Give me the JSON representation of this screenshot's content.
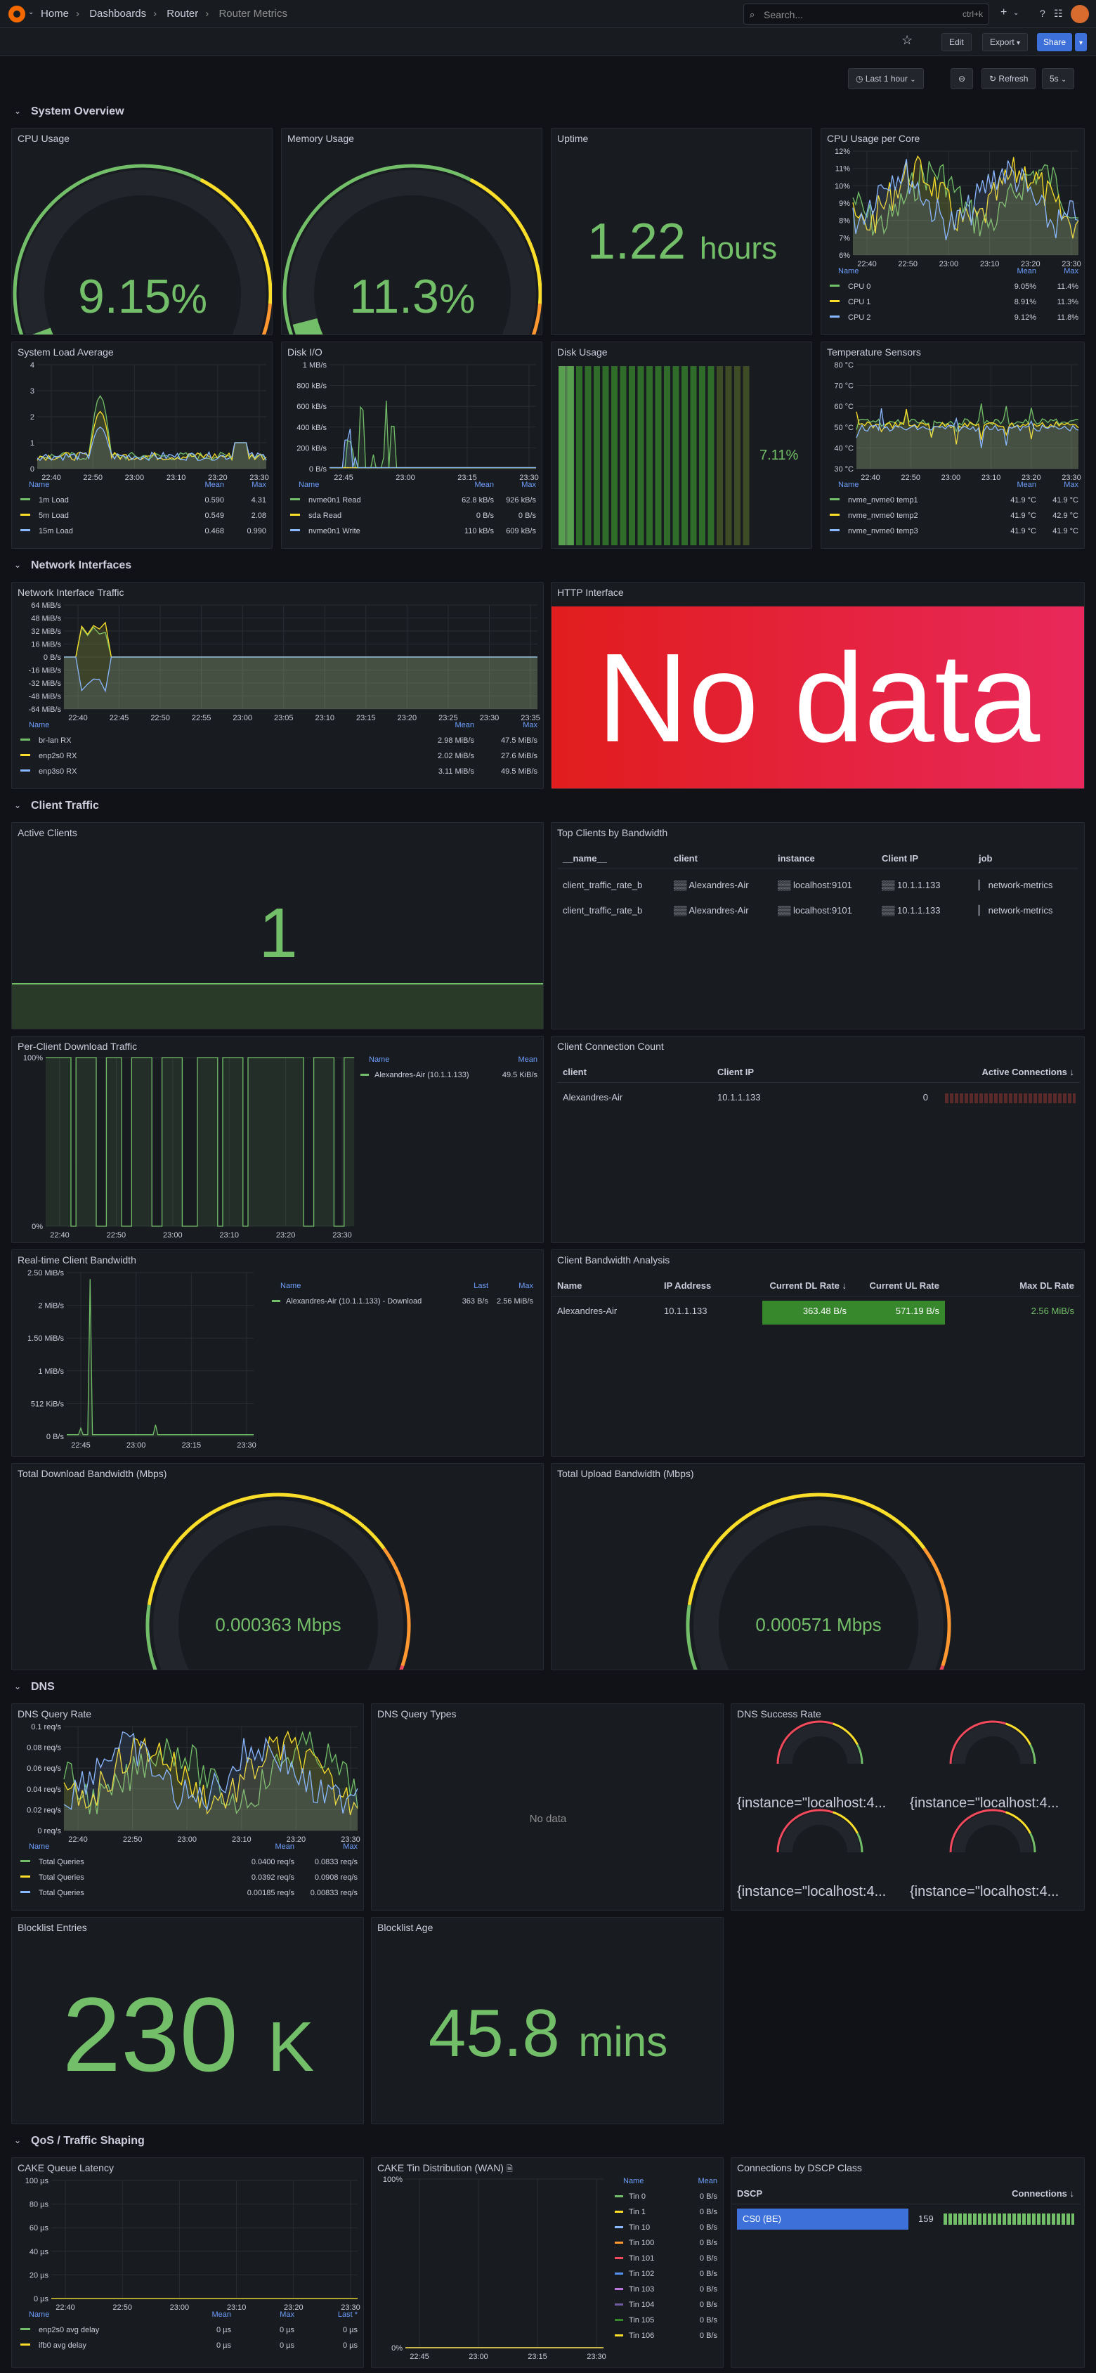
{
  "nav": {
    "crumbs": [
      "Home",
      "Dashboards",
      "Router",
      "Router Metrics"
    ],
    "search_placeholder": "Search...",
    "search_shortcut": "ctrl+k",
    "plus": "+"
  },
  "toolbar": {
    "edit": "Edit",
    "export": "Export",
    "share": "Share",
    "time_range": "Last 1 hour",
    "refresh": "Refresh",
    "refresh_interval": "5s"
  },
  "sections": {
    "system": "System Overview",
    "network": "Network Interfaces",
    "client": "Client Traffic",
    "dns": "DNS",
    "qos": "QoS / Traffic Shaping"
  },
  "cpu": {
    "title": "CPU Usage",
    "value": "9.15",
    "unit": "%",
    "fraction": 0.0915
  },
  "mem": {
    "title": "Memory Usage",
    "value": "11.3",
    "unit": "%",
    "fraction": 0.113
  },
  "uptime": {
    "title": "Uptime",
    "value": "1.22",
    "unit": "hours"
  },
  "cpucore": {
    "title": "CPU Usage per Core",
    "yticks": [
      "12%",
      "11%",
      "10%",
      "9%",
      "8%",
      "7%",
      "6%"
    ],
    "xticks": [
      "22:40",
      "22:50",
      "23:00",
      "23:10",
      "23:20",
      "23:30"
    ],
    "legend_cols": [
      "Name",
      "Mean",
      "Max"
    ],
    "rows": [
      {
        "name": "CPU 0",
        "mean": "9.05%",
        "max": "11.4%",
        "color": "#73bf69"
      },
      {
        "name": "CPU 1",
        "mean": "8.91%",
        "max": "11.3%",
        "color": "#fade2a"
      },
      {
        "name": "CPU 2",
        "mean": "9.12%",
        "max": "11.8%",
        "color": "#8ab8ff"
      }
    ]
  },
  "load": {
    "title": "System Load Average",
    "yticks": [
      "4",
      "3",
      "2",
      "1",
      "0"
    ],
    "xticks": [
      "22:40",
      "22:50",
      "23:00",
      "23:10",
      "23:20",
      "23:30"
    ],
    "legend_cols": [
      "Name",
      "Mean",
      "Max"
    ],
    "rows": [
      {
        "name": "1m Load",
        "mean": "0.590",
        "max": "4.31",
        "color": "#73bf69"
      },
      {
        "name": "5m Load",
        "mean": "0.549",
        "max": "2.08",
        "color": "#fade2a"
      },
      {
        "name": "15m Load",
        "mean": "0.468",
        "max": "0.990",
        "color": "#8ab8ff"
      }
    ]
  },
  "diskio": {
    "title": "Disk I/O",
    "yticks": [
      "1 MB/s",
      "800 kB/s",
      "600 kB/s",
      "400 kB/s",
      "200 kB/s",
      "0 B/s"
    ],
    "xticks": [
      "22:45",
      "23:00",
      "23:15",
      "23:30"
    ],
    "legend_cols": [
      "Name",
      "Mean",
      "Max"
    ],
    "rows": [
      {
        "name": "nvme0n1 Read",
        "mean": "62.8 kB/s",
        "max": "926 kB/s",
        "color": "#73bf69"
      },
      {
        "name": "sda Read",
        "mean": "0 B/s",
        "max": "0 B/s",
        "color": "#fade2a"
      },
      {
        "name": "nvme0n1 Write",
        "mean": "110 kB/s",
        "max": "609 kB/s",
        "color": "#8ab8ff"
      }
    ]
  },
  "disk": {
    "title": "Disk Usage",
    "value": "7.11%",
    "fraction": 0.0711
  },
  "temp": {
    "title": "Temperature Sensors",
    "yticks": [
      "80 °C",
      "70 °C",
      "60 °C",
      "50 °C",
      "40 °C",
      "30 °C"
    ],
    "xticks": [
      "22:40",
      "22:50",
      "23:00",
      "23:10",
      "23:20",
      "23:30"
    ],
    "legend_cols": [
      "Name",
      "Mean",
      "Max"
    ],
    "rows": [
      {
        "name": "nvme_nvme0 temp1",
        "mean": "41.9 °C",
        "max": "41.9 °C",
        "color": "#73bf69"
      },
      {
        "name": "nvme_nvme0 temp2",
        "mean": "41.9 °C",
        "max": "42.9 °C",
        "color": "#fade2a"
      },
      {
        "name": "nvme_nvme0 temp3",
        "mean": "41.9 °C",
        "max": "41.9 °C",
        "color": "#8ab8ff"
      }
    ]
  },
  "netif": {
    "title": "Network Interface Traffic",
    "yticks": [
      "64 MiB/s",
      "48 MiB/s",
      "32 MiB/s",
      "16 MiB/s",
      "0 B/s",
      "-16 MiB/s",
      "-32 MiB/s",
      "-48 MiB/s",
      "-64 MiB/s"
    ],
    "xticks": [
      "22:40",
      "22:45",
      "22:50",
      "22:55",
      "23:00",
      "23:05",
      "23:10",
      "23:15",
      "23:20",
      "23:25",
      "23:30",
      "23:35"
    ],
    "legend_cols": [
      "Name",
      "Mean",
      "Max"
    ],
    "rows": [
      {
        "name": "br-lan RX",
        "mean": "2.98 MiB/s",
        "max": "47.5 MiB/s",
        "color": "#73bf69"
      },
      {
        "name": "enp2s0 RX",
        "mean": "2.02 MiB/s",
        "max": "27.6 MiB/s",
        "color": "#fade2a"
      },
      {
        "name": "enp3s0 RX",
        "mean": "3.11 MiB/s",
        "max": "49.5 MiB/s",
        "color": "#8ab8ff"
      }
    ]
  },
  "http": {
    "title": "HTTP Interface",
    "value": "No data"
  },
  "active": {
    "title": "Active Clients",
    "value": "1"
  },
  "topclients": {
    "title": "Top Clients by Bandwidth",
    "cols": [
      "__name__",
      "client",
      "instance",
      "Client IP",
      "job"
    ],
    "rows": [
      [
        "client_traffic_rate_b",
        "Alexandres-Air",
        "localhost:9101",
        "10.1.1.133",
        "network-metrics"
      ],
      [
        "client_traffic_rate_b",
        "Alexandres-Air",
        "localhost:9101",
        "10.1.1.133",
        "network-metrics"
      ]
    ]
  },
  "perclient": {
    "title": "Per-Client Download Traffic",
    "yticks": [
      "100%",
      "0%"
    ],
    "xticks": [
      "22:40",
      "22:50",
      "23:00",
      "23:10",
      "23:20",
      "23:30"
    ],
    "legend_cols": [
      "Name",
      "Mean"
    ],
    "rows": [
      {
        "name": "Alexandres-Air (10.1.1.133)",
        "mean": "49.5 KiB/s",
        "color": "#73bf69"
      }
    ]
  },
  "conncount": {
    "title": "Client Connection Count",
    "cols": [
      "client",
      "Client IP",
      "Active Connections"
    ],
    "rows": [
      {
        "client": "Alexandres-Air",
        "ip": "10.1.1.133",
        "count": "0"
      }
    ]
  },
  "rtbw": {
    "title": "Real-time Client Bandwidth",
    "yticks": [
      "2.50 MiB/s",
      "2 MiB/s",
      "1.50 MiB/s",
      "1 MiB/s",
      "512 KiB/s",
      "0 B/s"
    ],
    "xticks": [
      "22:45",
      "23:00",
      "23:15",
      "23:30"
    ],
    "legend_cols": [
      "Name",
      "Last",
      "Max"
    ],
    "rows": [
      {
        "name": "Alexandres-Air (10.1.1.133) - Download",
        "last": "363 B/s",
        "max": "2.56 MiB/s",
        "color": "#73bf69"
      }
    ]
  },
  "bwanalysis": {
    "title": "Client Bandwidth Analysis",
    "cols": [
      "Name",
      "IP Address",
      "Current DL Rate",
      "Current UL Rate",
      "Max DL Rate"
    ],
    "rows": [
      {
        "name": "Alexandres-Air",
        "ip": "10.1.1.133",
        "dl": "363.48 B/s",
        "ul": "571.19 B/s",
        "max": "2.56 MiB/s"
      }
    ]
  },
  "totaldl": {
    "title": "Total Download Bandwidth (Mbps)",
    "value": "0.000363 Mbps"
  },
  "totalul": {
    "title": "Total Upload Bandwidth (Mbps)",
    "value": "0.000571 Mbps"
  },
  "dnsrate": {
    "title": "DNS Query Rate",
    "yticks": [
      "0.1 req/s",
      "0.08 req/s",
      "0.06 req/s",
      "0.04 req/s",
      "0.02 req/s",
      "0 req/s"
    ],
    "xticks": [
      "22:40",
      "22:50",
      "23:00",
      "23:10",
      "23:20",
      "23:30"
    ],
    "legend_cols": [
      "Name",
      "Mean",
      "Max"
    ],
    "rows": [
      {
        "name": "Total Queries",
        "mean": "0.0400 req/s",
        "max": "0.0833 req/s",
        "color": "#73bf69"
      },
      {
        "name": "Total Queries",
        "mean": "0.0392 req/s",
        "max": "0.0908 req/s",
        "color": "#fade2a"
      },
      {
        "name": "Total Queries",
        "mean": "0.00185 req/s",
        "max": "0.00833 req/s",
        "color": "#8ab8ff"
      }
    ]
  },
  "dnstypes": {
    "title": "DNS Query Types",
    "value": "No data"
  },
  "dnssuccess": {
    "title": "DNS Success Rate",
    "labels": [
      "{instance=\"localhost:4...",
      "{instance=\"localhost:4...",
      "{instance=\"localhost:4...",
      "{instance=\"localhost:4..."
    ]
  },
  "blocklist": {
    "title": "Blocklist Entries",
    "value": "230",
    "unit": "K"
  },
  "blockage": {
    "title": "Blocklist Age",
    "value": "45.8",
    "unit": "mins"
  },
  "cakelat": {
    "title": "CAKE Queue Latency",
    "yticks": [
      "100 µs",
      "80 µs",
      "60 µs",
      "40 µs",
      "20 µs",
      "0 µs"
    ],
    "xticks": [
      "22:40",
      "22:50",
      "23:00",
      "23:10",
      "23:20",
      "23:30"
    ],
    "legend_cols": [
      "Name",
      "Mean",
      "Max",
      "Last *"
    ],
    "rows": [
      {
        "name": "enp2s0 avg delay",
        "mean": "0 µs",
        "max": "0 µs",
        "last": "0 µs",
        "color": "#73bf69"
      },
      {
        "name": "ifb0 avg delay",
        "mean": "0 µs",
        "max": "0 µs",
        "last": "0 µs",
        "color": "#fade2a"
      }
    ]
  },
  "caketin": {
    "title": "CAKE Tin Distribution (WAN)",
    "yticks": [
      "100%",
      "0%"
    ],
    "xticks": [
      "22:45",
      "23:00",
      "23:15",
      "23:30"
    ],
    "legend_cols": [
      "Name",
      "Mean"
    ],
    "rows": [
      {
        "name": "Tin 0",
        "mean": "0 B/s",
        "color": "#73bf69"
      },
      {
        "name": "Tin 1",
        "mean": "0 B/s",
        "color": "#fade2a"
      },
      {
        "name": "Tin 10",
        "mean": "0 B/s",
        "color": "#8ab8ff"
      },
      {
        "name": "Tin 100",
        "mean": "0 B/s",
        "color": "#ff9830"
      },
      {
        "name": "Tin 101",
        "mean": "0 B/s",
        "color": "#f2495c"
      },
      {
        "name": "Tin 102",
        "mean": "0 B/s",
        "color": "#5794f2"
      },
      {
        "name": "Tin 103",
        "mean": "0 B/s",
        "color": "#b877d9"
      },
      {
        "name": "Tin 104",
        "mean": "0 B/s",
        "color": "#705da0"
      },
      {
        "name": "Tin 105",
        "mean": "0 B/s",
        "color": "#37872d"
      },
      {
        "name": "Tin 106",
        "mean": "0 B/s",
        "color": "#fade2a"
      }
    ]
  },
  "dscp": {
    "title": "Connections by DSCP Class",
    "cols": [
      "DSCP",
      "Connections"
    ],
    "rows": [
      {
        "name": "CS0 (BE)",
        "count": "159"
      }
    ]
  }
}
